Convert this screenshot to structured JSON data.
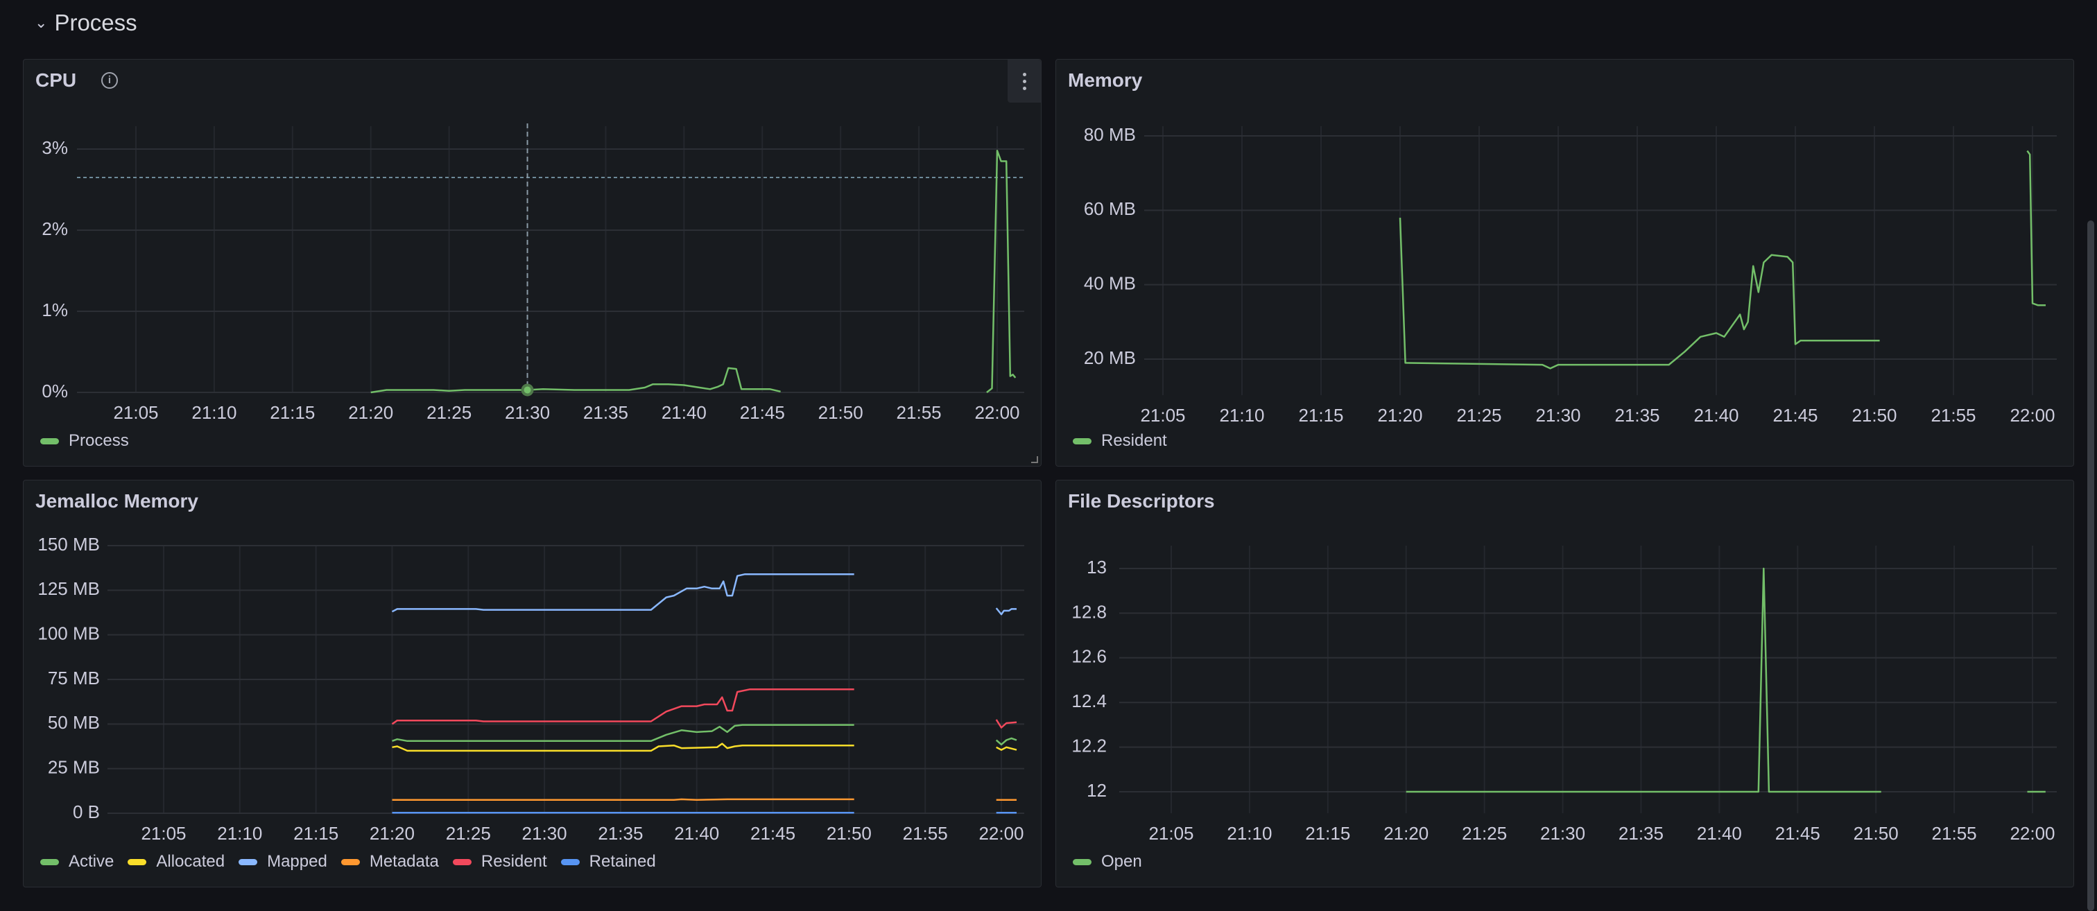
{
  "section": {
    "title": "Process",
    "icon": "chevron-down-icon"
  },
  "colors": {
    "green": "#73bf69",
    "yellow": "#fade2a",
    "lightblue": "#8ab8ff",
    "orange": "#ff9830",
    "red": "#f2495c",
    "blue": "#5794f2",
    "threshold": "#6e8a99"
  },
  "x_ticks": [
    "21:05",
    "21:10",
    "21:15",
    "21:20",
    "21:25",
    "21:30",
    "21:35",
    "21:40",
    "21:45",
    "21:50",
    "21:55",
    "22:00"
  ],
  "panels": {
    "cpu": {
      "title": "CPU",
      "has_info_icon": true,
      "chart_data": {
        "type": "line",
        "y_ticks": [
          {
            "v": 0,
            "label": "0%"
          },
          {
            "v": 1,
            "label": "1%"
          },
          {
            "v": 2,
            "label": "2%"
          },
          {
            "v": 3,
            "label": "3%"
          }
        ],
        "unit": "%",
        "threshold_line": 2.65,
        "crosshair_time": "21:30:00",
        "crosshair_value": 0.03,
        "series": [
          {
            "name": "Process",
            "color": "#73bf69",
            "points": [
              [
                "21:20:00",
                0.0
              ],
              [
                "21:21:00",
                0.03
              ],
              [
                "21:24:00",
                0.03
              ],
              [
                "21:25:00",
                0.02
              ],
              [
                "21:26:00",
                0.03
              ],
              [
                "21:30:00",
                0.03
              ],
              [
                "21:31:00",
                0.04
              ],
              [
                "21:33:00",
                0.03
              ],
              [
                "21:36:30",
                0.03
              ],
              [
                "21:37:30",
                0.06
              ],
              [
                "21:38:00",
                0.1
              ],
              [
                "21:39:00",
                0.1
              ],
              [
                "21:40:00",
                0.09
              ],
              [
                "21:41:00",
                0.06
              ],
              [
                "21:41:40",
                0.04
              ],
              [
                "21:42:10",
                0.07
              ],
              [
                "21:42:30",
                0.1
              ],
              [
                "21:42:50",
                0.3
              ],
              [
                "21:43:20",
                0.29
              ],
              [
                "21:43:40",
                0.04
              ],
              [
                "21:45:30",
                0.04
              ],
              [
                "21:46:10",
                0.01
              ],
              null,
              [
                "21:59:20",
                0.0
              ],
              [
                "21:59:40",
                0.05
              ],
              [
                "22:00:00",
                2.98
              ],
              [
                "22:00:15",
                2.85
              ],
              [
                "22:00:35",
                2.85
              ],
              [
                "22:00:50",
                0.2
              ],
              [
                "22:01:00",
                0.22
              ],
              [
                "22:01:10",
                0.18
              ]
            ]
          }
        ]
      }
    },
    "memory": {
      "title": "Memory",
      "chart_data": {
        "type": "line",
        "y_ticks": [
          {
            "v": 20,
            "label": "20 MB"
          },
          {
            "v": 40,
            "label": "40 MB"
          },
          {
            "v": 60,
            "label": "60 MB"
          },
          {
            "v": 80,
            "label": "80 MB"
          }
        ],
        "series": [
          {
            "name": "Resident",
            "color": "#73bf69",
            "points": [
              [
                "21:20:00",
                58
              ],
              [
                "21:20:20",
                19
              ],
              [
                "21:29:00",
                18.5
              ],
              [
                "21:29:30",
                17.5
              ],
              [
                "21:30:00",
                18.5
              ],
              [
                "21:37:00",
                18.5
              ],
              [
                "21:38:00",
                22
              ],
              [
                "21:39:00",
                26
              ],
              [
                "21:40:00",
                27
              ],
              [
                "21:40:30",
                26
              ],
              [
                "21:41:00",
                29
              ],
              [
                "21:41:30",
                32
              ],
              [
                "21:41:45",
                28
              ],
              [
                "21:42:00",
                30
              ],
              [
                "21:42:20",
                45
              ],
              [
                "21:42:40",
                38
              ],
              [
                "21:43:00",
                46
              ],
              [
                "21:43:30",
                48
              ],
              [
                "21:44:30",
                47.5
              ],
              [
                "21:44:50",
                46
              ],
              [
                "21:45:00",
                24
              ],
              [
                "21:45:20",
                25
              ],
              [
                "21:50:20",
                25
              ],
              null,
              [
                "21:59:40",
                76
              ],
              [
                "21:59:50",
                75
              ],
              [
                "22:00:00",
                35
              ],
              [
                "22:00:20",
                34.5
              ],
              [
                "22:00:50",
                34.5
              ]
            ]
          }
        ]
      }
    },
    "jemalloc": {
      "title": "Jemalloc Memory",
      "chart_data": {
        "type": "line",
        "y_ticks": [
          {
            "v": 0,
            "label": "0 B"
          },
          {
            "v": 25,
            "label": "25 MB"
          },
          {
            "v": 50,
            "label": "50 MB"
          },
          {
            "v": 75,
            "label": "75 MB"
          },
          {
            "v": 100,
            "label": "100 MB"
          },
          {
            "v": 125,
            "label": "125 MB"
          },
          {
            "v": 150,
            "label": "150 MB"
          }
        ],
        "series": [
          {
            "name": "Active",
            "color": "#73bf69",
            "points": [
              [
                "21:20:00",
                40.5
              ],
              [
                "21:20:20",
                41.5
              ],
              [
                "21:21:00",
                40.5
              ],
              [
                "21:37:00",
                40.5
              ],
              [
                "21:38:00",
                44
              ],
              [
                "21:39:00",
                46.5
              ],
              [
                "21:40:00",
                45.5
              ],
              [
                "21:41:00",
                46
              ],
              [
                "21:41:30",
                48.5
              ],
              [
                "21:42:00",
                45.5
              ],
              [
                "21:42:30",
                49
              ],
              [
                "21:43:00",
                49.5
              ],
              [
                "21:50:20",
                49.5
              ],
              null,
              [
                "21:59:40",
                41
              ],
              [
                "22:00:00",
                38.5
              ],
              [
                "22:00:20",
                41
              ],
              [
                "22:00:40",
                42
              ],
              [
                "22:01:00",
                41
              ]
            ]
          },
          {
            "name": "Allocated",
            "color": "#fade2a",
            "points": [
              [
                "21:20:00",
                37
              ],
              [
                "21:20:20",
                37.5
              ],
              [
                "21:21:00",
                35
              ],
              [
                "21:37:00",
                35
              ],
              [
                "21:37:30",
                37.5
              ],
              [
                "21:38:30",
                38
              ],
              [
                "21:39:00",
                36.5
              ],
              [
                "21:41:20",
                37
              ],
              [
                "21:41:40",
                39
              ],
              [
                "21:42:00",
                36.5
              ],
              [
                "21:42:30",
                37.5
              ],
              [
                "21:43:00",
                38
              ],
              [
                "21:50:20",
                38
              ],
              null,
              [
                "21:59:40",
                37
              ],
              [
                "22:00:00",
                35.5
              ],
              [
                "22:00:20",
                37
              ],
              [
                "22:01:00",
                35.5
              ]
            ]
          },
          {
            "name": "Mapped",
            "color": "#8ab8ff",
            "points": [
              [
                "21:20:00",
                113
              ],
              [
                "21:20:20",
                114.5
              ],
              [
                "21:25:30",
                114.5
              ],
              [
                "21:26:00",
                114
              ],
              [
                "21:37:00",
                114
              ],
              [
                "21:38:00",
                121
              ],
              [
                "21:38:30",
                122
              ],
              [
                "21:39:20",
                126
              ],
              [
                "21:40:00",
                126
              ],
              [
                "21:40:30",
                127
              ],
              [
                "21:41:00",
                126
              ],
              [
                "21:41:30",
                126
              ],
              [
                "21:41:45",
                130
              ],
              [
                "21:42:00",
                122
              ],
              [
                "21:42:20",
                122
              ],
              [
                "21:42:40",
                133
              ],
              [
                "21:43:10",
                134
              ],
              [
                "21:50:20",
                134
              ],
              null,
              [
                "21:59:40",
                115
              ],
              [
                "22:00:00",
                111.5
              ],
              [
                "22:00:10",
                113.5
              ],
              [
                "22:00:30",
                113.5
              ],
              [
                "22:00:40",
                114.5
              ],
              [
                "22:01:00",
                114.5
              ]
            ]
          },
          {
            "name": "Metadata",
            "color": "#ff9830",
            "points": [
              [
                "21:20:00",
                7.5
              ],
              [
                "21:38:30",
                7.5
              ],
              [
                "21:39:00",
                7.8
              ],
              [
                "21:40:00",
                7.5
              ],
              [
                "21:42:00",
                7.8
              ],
              [
                "21:50:20",
                7.8
              ],
              null,
              [
                "21:59:40",
                7.5
              ],
              [
                "22:01:00",
                7.5
              ]
            ]
          },
          {
            "name": "Resident",
            "color": "#f2495c",
            "points": [
              [
                "21:20:00",
                50
              ],
              [
                "21:20:20",
                52
              ],
              [
                "21:25:30",
                52
              ],
              [
                "21:26:00",
                51.5
              ],
              [
                "21:37:00",
                51.5
              ],
              [
                "21:38:00",
                57
              ],
              [
                "21:39:00",
                60
              ],
              [
                "21:40:00",
                60
              ],
              [
                "21:40:30",
                61
              ],
              [
                "21:41:20",
                61
              ],
              [
                "21:41:40",
                65
              ],
              [
                "21:42:00",
                57.5
              ],
              [
                "21:42:20",
                57.5
              ],
              [
                "21:42:40",
                68
              ],
              [
                "21:43:30",
                69.5
              ],
              [
                "21:50:20",
                69.5
              ],
              null,
              [
                "21:59:40",
                52.5
              ],
              [
                "22:00:00",
                48
              ],
              [
                "22:00:20",
                50.5
              ],
              [
                "22:01:00",
                51
              ]
            ]
          },
          {
            "name": "Retained",
            "color": "#5794f2",
            "points": [
              [
                "21:20:00",
                0.3
              ],
              [
                "21:50:20",
                0.3
              ],
              null,
              [
                "21:59:40",
                0.3
              ],
              [
                "22:01:00",
                0.3
              ]
            ]
          }
        ]
      }
    },
    "fd": {
      "title": "File Descriptors",
      "chart_data": {
        "type": "line",
        "y_ticks": [
          {
            "v": 12,
            "label": "12"
          },
          {
            "v": 12.2,
            "label": "12.2"
          },
          {
            "v": 12.4,
            "label": "12.4"
          },
          {
            "v": 12.6,
            "label": "12.6"
          },
          {
            "v": 12.8,
            "label": "12.8"
          },
          {
            "v": 13,
            "label": "13"
          }
        ],
        "series": [
          {
            "name": "Open",
            "color": "#73bf69",
            "points": [
              [
                "21:20:00",
                12
              ],
              [
                "21:42:30",
                12
              ],
              [
                "21:42:50",
                13
              ],
              [
                "21:43:10",
                12
              ],
              [
                "21:50:20",
                12
              ],
              null,
              [
                "21:59:40",
                12
              ],
              [
                "22:00:50",
                12
              ]
            ]
          }
        ]
      }
    }
  }
}
